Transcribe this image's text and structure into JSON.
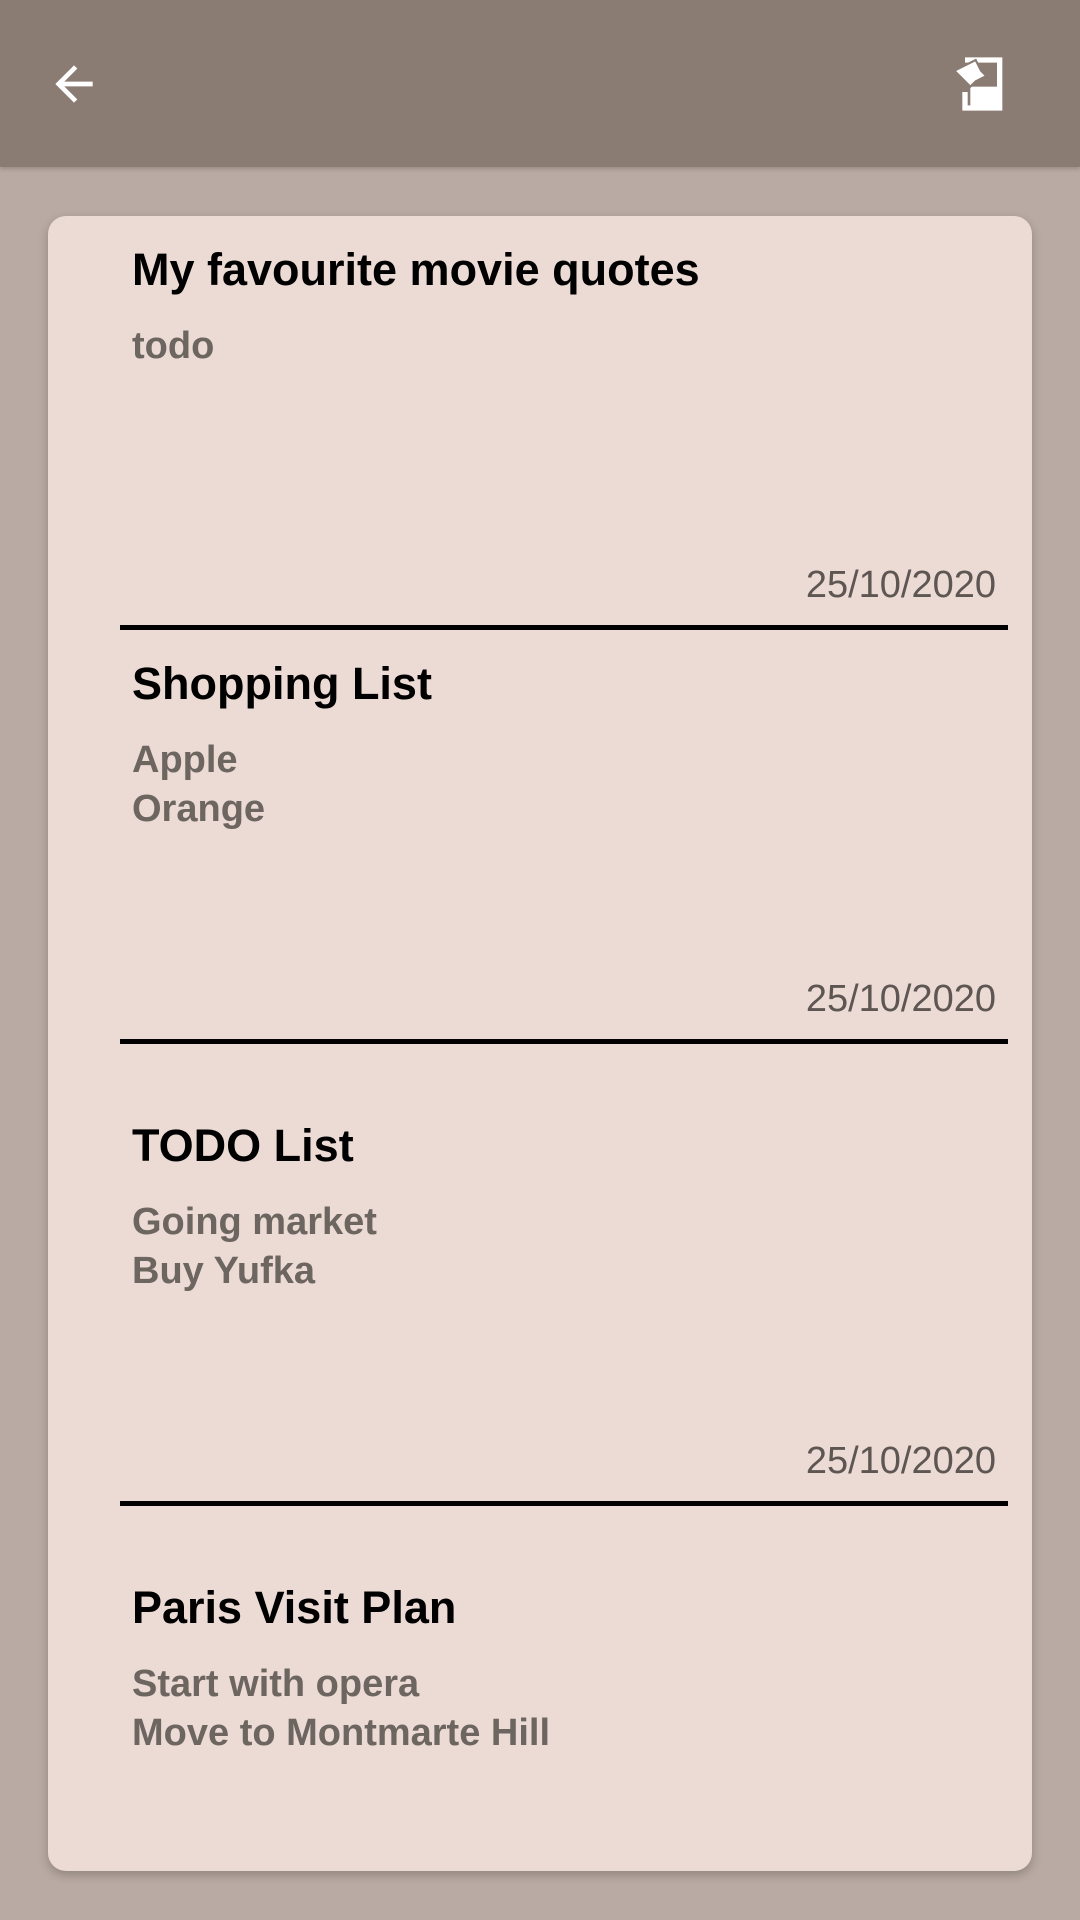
{
  "app_bar": {
    "back_icon": "arrow-back-icon",
    "export_icon": "export-image-icon",
    "background": "#8a7b73"
  },
  "notes": [
    {
      "title": "My favourite movie quotes",
      "lines": [
        "todo"
      ],
      "date": "25/10/2020"
    },
    {
      "title": "Shopping List",
      "lines": [
        "Apple",
        "Orange"
      ],
      "date": "25/10/2020"
    },
    {
      "title": "TODO List",
      "lines": [
        "Going market",
        "Buy Yufka"
      ],
      "date": "25/10/2020"
    },
    {
      "title": "Paris Visit Plan",
      "lines": [
        "Start with opera",
        "Move to Montmarte Hill"
      ]
    }
  ],
  "colors": {
    "page_background": "#b9aaa3",
    "card_background": "#ecdad5",
    "title_text": "#000000",
    "body_text": "#6d655f"
  }
}
